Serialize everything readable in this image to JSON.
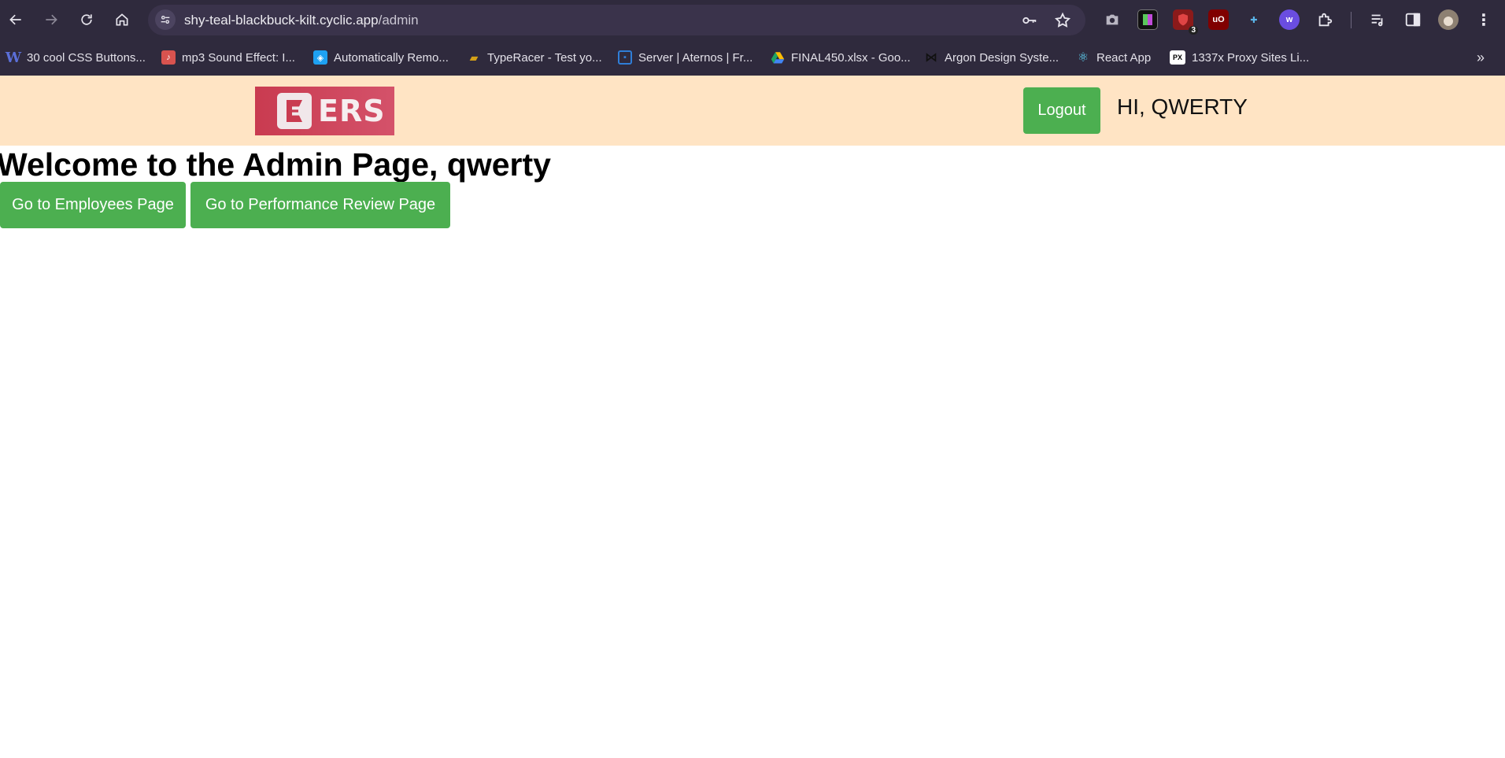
{
  "browser": {
    "url_host": "shy-teal-blackbuck-kilt.cyclic.app",
    "url_path": "/admin",
    "extension_badge": "3",
    "bookmarks": [
      {
        "label": "30 cool CSS Buttons...",
        "icon": "w-letter-icon",
        "color": "#5b6fd8",
        "glyph": "W"
      },
      {
        "label": "mp3 Sound Effect: I...",
        "icon": "music-note-icon",
        "color": "#d9534f",
        "glyph": "♪"
      },
      {
        "label": "Automatically Remo...",
        "icon": "remove-bg-icon",
        "color": "#1ea1f2",
        "glyph": "◈"
      },
      {
        "label": "TypeRacer - Test yo...",
        "icon": "typeracer-icon",
        "color": "#d4a017",
        "glyph": "🏎"
      },
      {
        "label": "Server | Aternos | Fr...",
        "icon": "aternos-icon",
        "color": "#2f7ed8",
        "glyph": "▣"
      },
      {
        "label": "FINAL450.xlsx - Goo...",
        "icon": "google-drive-icon",
        "color": "#1fa463",
        "glyph": "▲"
      },
      {
        "label": "Argon Design Syste...",
        "icon": "bowtie-icon",
        "color": "#1b1b1b",
        "glyph": "⋈"
      },
      {
        "label": "React App",
        "icon": "react-icon",
        "color": "#61dafb",
        "glyph": "⚛"
      },
      {
        "label": "1337x Proxy Sites Li...",
        "icon": "1337x-icon",
        "color": "#ffffff",
        "glyph": "PX"
      }
    ]
  },
  "header": {
    "logo_text": "ERS",
    "logout_label": "Logout",
    "greeting": "HI, QWERTY"
  },
  "main": {
    "welcome": "Welcome to the Admin Page, qwerty",
    "employees_button": "Go to Employees Page",
    "reviews_button": "Go to Performance Review Page"
  },
  "colors": {
    "header_bg": "#ffe4c4",
    "button_green": "#4caf50",
    "logo_red": "#c93b50",
    "chrome_bg": "#2f2a3d"
  }
}
